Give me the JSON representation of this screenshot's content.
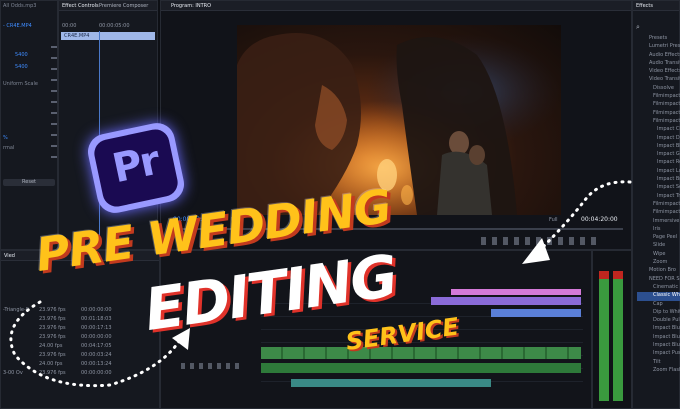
{
  "left_panel": {
    "file_label": "All Odds.mp3",
    "sequence_label": "- CR4E.MP4",
    "values": [
      "5400",
      "5400"
    ],
    "uniform_scale": "Uniform Scale",
    "percent": "%",
    "blend": "rmal",
    "button_label": "Reset",
    "video_label": "Vied",
    "fps_rows": [
      {
        "name": "-Triangle-S",
        "fps": "23.976 fps",
        "tc": "00:00:00:00"
      },
      {
        "name": "",
        "fps": "23.976 fps",
        "tc": "00:01:18:03"
      },
      {
        "name": "",
        "fps": "23.976 fps",
        "tc": "00:00:17:13"
      },
      {
        "name": "",
        "fps": "23.976 fps",
        "tc": "00:00:00:00"
      },
      {
        "name": "",
        "fps": "24.00 fps",
        "tc": "00:04:17:05"
      },
      {
        "name": "",
        "fps": "23.976 fps",
        "tc": "00:00:03:24"
      },
      {
        "name": "",
        "fps": "24.00 fps",
        "tc": "00:00:13:24"
      },
      {
        "name": "3-00 Ov",
        "fps": "23.976 fps",
        "tc": "00:00:00:00"
      }
    ]
  },
  "effect_controls": {
    "tab_label": "Effect Controls",
    "tab2_label": "Premiere Composer",
    "tc_start": "00:00",
    "tc_end": "00:00:05:00",
    "clip_label": "CR4E.MP4"
  },
  "program_monitor": {
    "title": "Program: INTRO",
    "timecode_left": "00:00:03:18",
    "fit_label": "Fit",
    "quality_label": "Full",
    "timecode_right": "00:04:20:00"
  },
  "effects_panel": {
    "title": "Effects",
    "items": [
      "Presets",
      "Lumetri Presets",
      "Audio Effects",
      "Audio Transitio",
      "Video Effects",
      "Video Transitio",
      "Dissolve",
      "Filmimpact",
      "Filmimpact",
      "Filmimpact",
      "Filmimpact",
      "Impact Ch",
      "Impact Di",
      "Impact Bl",
      "Impact Gl",
      "Impact Re",
      "Impact Lu",
      "Impact Br",
      "Impact Se",
      "Impact Tr",
      "Filmimpact",
      "Filmimpact",
      "Immersive",
      "Iris",
      "Page Peel",
      "Slide",
      "Wipe",
      "Zoom",
      "Motion Bro",
      "NEED FOR SP",
      "Cinematic Ba",
      "Classic Whi",
      "Cap",
      "Dip to White",
      "Double Pullip",
      "Impact Blur",
      "Impact Blu",
      "Impact Blur",
      "Impact Pus",
      "Tilt",
      "Zoom Flash"
    ]
  },
  "app_icon": {
    "label": "Pr"
  },
  "headline": {
    "line1": "PRE WEDDING",
    "line2": "EDITING",
    "line3": "SERVICE"
  },
  "colors": {
    "accent_yellow": "#ffc21a",
    "accent_red": "#d9352a",
    "premiere_purple": "#9999ff",
    "premiere_bg": "#1a0a52",
    "panel_bg": "#15181f"
  }
}
